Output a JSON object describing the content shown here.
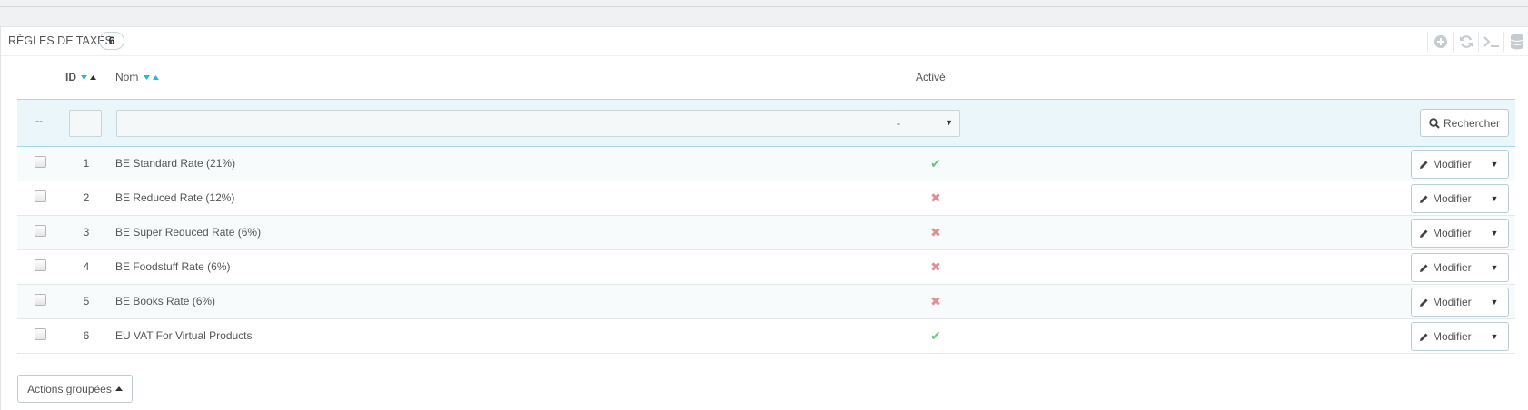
{
  "panel": {
    "title": "Règles de taxes",
    "count": "6"
  },
  "toolbar_icons": [
    "add-icon",
    "refresh-icon",
    "sql-query-icon",
    "export-database-icon"
  ],
  "columns": {
    "id": "ID",
    "name": "Nom",
    "active": "Activé"
  },
  "filters": {
    "dash": "--",
    "id_value": "",
    "name_value": "",
    "active_selected": "-",
    "search_label": "Rechercher"
  },
  "rows": [
    {
      "id": "1",
      "name": "BE Standard Rate (21%)",
      "active": true,
      "edit_label": "Modifier"
    },
    {
      "id": "2",
      "name": "BE Reduced Rate (12%)",
      "active": false,
      "edit_label": "Modifier"
    },
    {
      "id": "3",
      "name": "BE Super Reduced Rate (6%)",
      "active": false,
      "edit_label": "Modifier"
    },
    {
      "id": "4",
      "name": "BE Foodstuff Rate (6%)",
      "active": false,
      "edit_label": "Modifier"
    },
    {
      "id": "5",
      "name": "BE Books Rate (6%)",
      "active": false,
      "edit_label": "Modifier"
    },
    {
      "id": "6",
      "name": "EU VAT For Virtual Products",
      "active": true,
      "edit_label": "Modifier"
    }
  ],
  "bulk_actions_label": "Actions groupées",
  "colors": {
    "active_ok": "#72c279",
    "active_no": "#e08f95",
    "filter_bg": "#eaf6fa",
    "sort_accent": "#25b9d7"
  }
}
